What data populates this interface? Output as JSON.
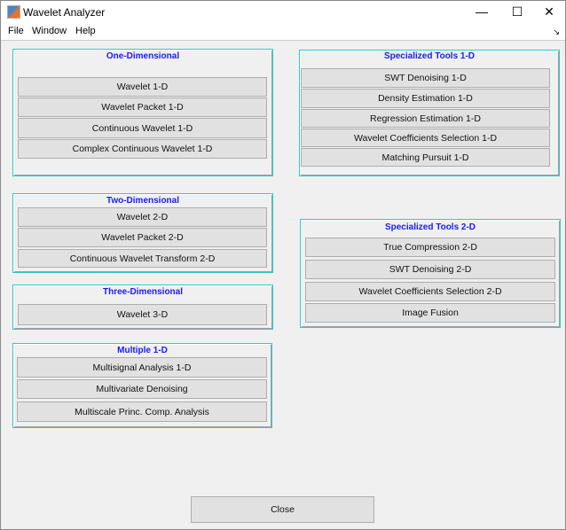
{
  "window": {
    "title": "Wavelet Analyzer",
    "minimize": "—",
    "maximize": "☐",
    "close": "✕"
  },
  "menu": [
    "File",
    "Window",
    "Help"
  ],
  "dock": "↘",
  "panels": {
    "one_d": {
      "title": "One-Dimensional",
      "buttons": [
        "Wavelet 1-D",
        "Wavelet Packet 1-D",
        "Continuous Wavelet 1-D",
        "Complex Continuous Wavelet 1-D"
      ]
    },
    "two_d": {
      "title": "Two-Dimensional",
      "buttons": [
        "Wavelet 2-D",
        "Wavelet Packet 2-D",
        "Continuous Wavelet Transform 2-D"
      ]
    },
    "three_d": {
      "title": "Three-Dimensional",
      "buttons": [
        "Wavelet 3-D"
      ]
    },
    "multiple": {
      "title": "Multiple 1-D",
      "buttons": [
        "Multisignal Analysis 1-D",
        "Multivariate Denoising",
        "Multiscale Princ. Comp. Analysis"
      ]
    },
    "spec1": {
      "title": "Specialized Tools 1-D",
      "buttons": [
        "SWT Denoising 1-D",
        "Density Estimation 1-D",
        "Regression Estimation 1-D",
        "Wavelet Coefficients Selection 1-D",
        "Matching Pursuit 1-D"
      ]
    },
    "spec2": {
      "title": "Specialized Tools 2-D",
      "buttons": [
        "True Compression 2-D",
        "SWT Denoising 2-D",
        "Wavelet Coefficients Selection 2-D",
        "Image Fusion"
      ]
    }
  },
  "close_label": "Close"
}
